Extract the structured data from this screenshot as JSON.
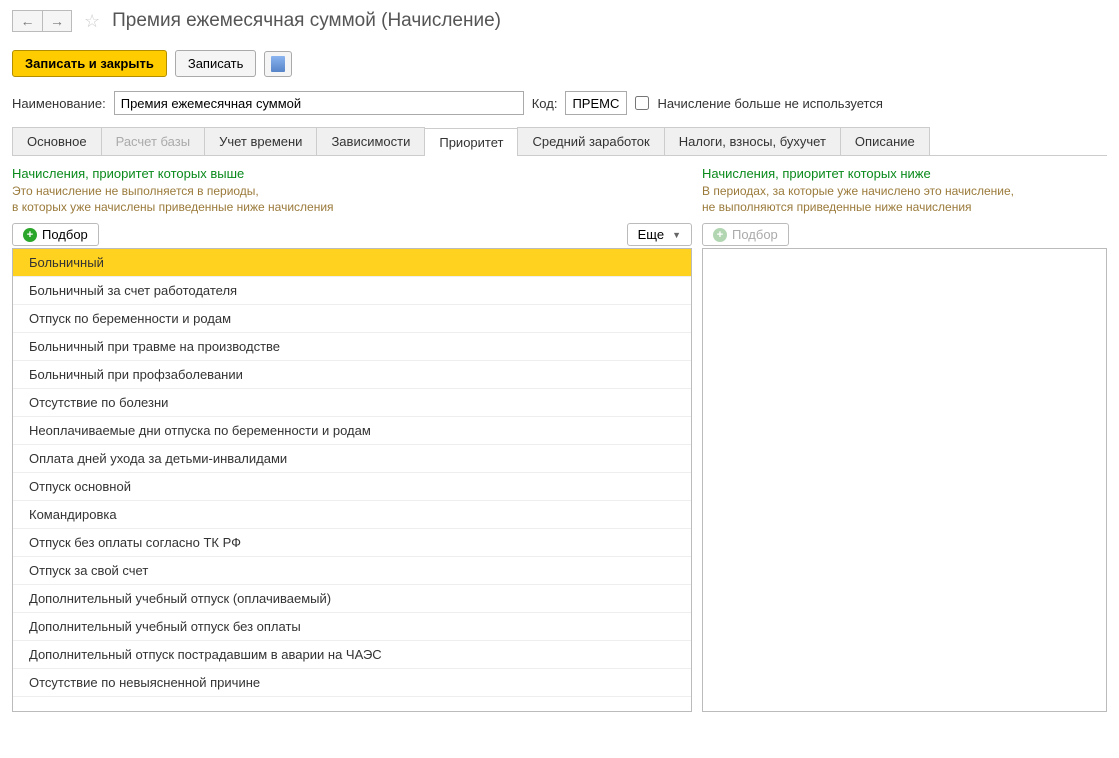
{
  "header": {
    "title": "Премия ежемесячная суммой (Начисление)"
  },
  "toolbar": {
    "save_close": "Записать и закрыть",
    "save": "Записать"
  },
  "form": {
    "name_label": "Наименование:",
    "name_value": "Премия ежемесячная суммой",
    "code_label": "Код:",
    "code_value": "ПРЕМС",
    "inactive_label": "Начисление больше не используется"
  },
  "tabs": [
    {
      "label": "Основное"
    },
    {
      "label": "Расчет базы",
      "disabled": true
    },
    {
      "label": "Учет времени"
    },
    {
      "label": "Зависимости"
    },
    {
      "label": "Приоритет",
      "active": true
    },
    {
      "label": "Средний заработок"
    },
    {
      "label": "Налоги, взносы, бухучет"
    },
    {
      "label": "Описание"
    }
  ],
  "left_panel": {
    "title": "Начисления, приоритет которых выше",
    "desc1": "Это начисление не выполняется в периоды,",
    "desc2": "в которых уже начислены приведенные ниже начисления",
    "pick": "Подбор",
    "more": "Еще",
    "items": [
      "Больничный",
      "Больничный за счет работодателя",
      "Отпуск по беременности и родам",
      "Больничный при травме на производстве",
      "Больничный при профзаболевании",
      "Отсутствие по болезни",
      "Неоплачиваемые дни отпуска по беременности и родам",
      "Оплата дней ухода за детьми-инвалидами",
      "Отпуск основной",
      "Командировка",
      "Отпуск без оплаты согласно ТК РФ",
      "Отпуск за свой счет",
      "Дополнительный учебный отпуск (оплачиваемый)",
      "Дополнительный учебный отпуск без оплаты",
      "Дополнительный отпуск пострадавшим в аварии на ЧАЭС",
      "Отсутствие по невыясненной причине"
    ]
  },
  "right_panel": {
    "title": "Начисления, приоритет которых ниже",
    "desc1": "В периодах, за которые уже начислено это начисление,",
    "desc2": "не выполняются приведенные ниже начисления",
    "pick": "Подбор"
  }
}
